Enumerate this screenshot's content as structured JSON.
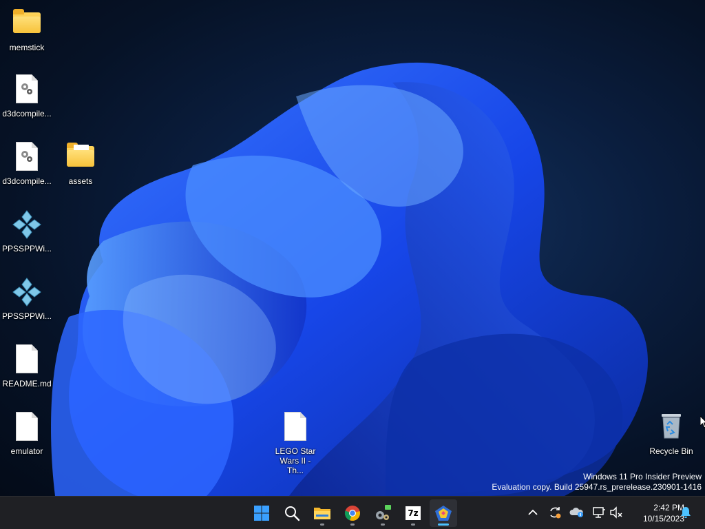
{
  "desktop": {
    "icons": [
      {
        "label": "memstick",
        "type": "folder-icon"
      },
      {
        "label": "d3dcompile...",
        "type": "settings-file-icon"
      },
      {
        "label": "d3dcompile...",
        "type": "settings-file-icon"
      },
      {
        "label": "assets",
        "type": "folder-icon"
      },
      {
        "label": "PPSSPPWi...",
        "type": "ppsspp-icon"
      },
      {
        "label": "PPSSPPWi...",
        "type": "ppsspp-icon"
      },
      {
        "label": "README.md",
        "type": "file-icon"
      },
      {
        "label": "emulator",
        "type": "file-icon"
      },
      {
        "label": "LEGO Star Wars II - Th...",
        "type": "file-icon"
      },
      {
        "label": "Recycle Bin",
        "type": "recycle-bin-icon"
      }
    ]
  },
  "watermark": {
    "line1": "Windows 11 Pro Insider Preview",
    "line2": "Evaluation copy. Build 25947.rs_prerelease.230901-1416"
  },
  "taskbar": {
    "apps": [
      "start-icon",
      "search-icon",
      "file-explorer-icon",
      "chrome-icon",
      "app-icon",
      "7zip-icon",
      "ppsspp-app-icon"
    ],
    "sevenzip_label": "7z",
    "tray": [
      "chevron-up-icon",
      "sync-icon",
      "onedrive-icon",
      "network-icon",
      "volume-muted-icon"
    ],
    "time": "2:42 PM",
    "date": "10/15/2023"
  },
  "colors": {
    "accent": "#4cc2ff",
    "taskbar": "#1f2024",
    "wallpaper_blue": "#1a4fff"
  }
}
